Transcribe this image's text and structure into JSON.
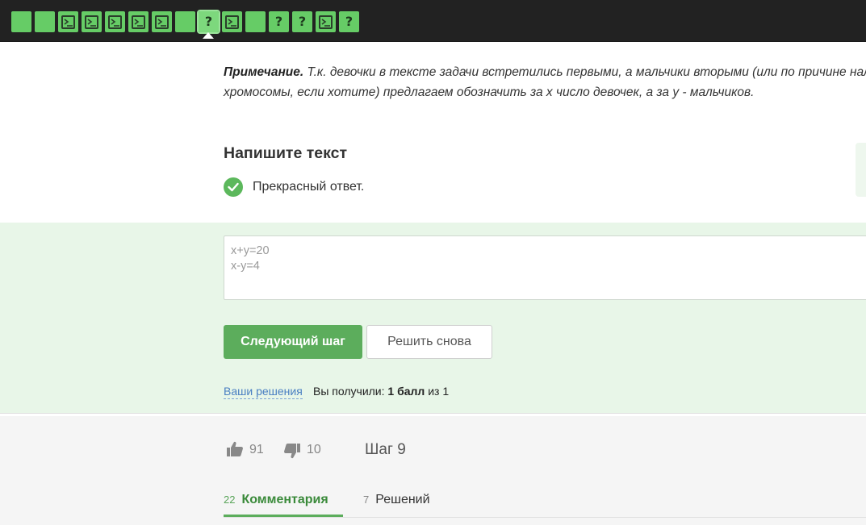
{
  "step_bar": {
    "steps": [
      {
        "kind": "plain",
        "icon": "blank-square",
        "state": "passed"
      },
      {
        "kind": "plain",
        "icon": "blank-square",
        "state": "passed"
      },
      {
        "kind": "code",
        "icon": "terminal-icon",
        "state": "passed"
      },
      {
        "kind": "code",
        "icon": "terminal-icon",
        "state": "passed"
      },
      {
        "kind": "code",
        "icon": "terminal-icon",
        "state": "passed"
      },
      {
        "kind": "code",
        "icon": "terminal-icon",
        "state": "passed"
      },
      {
        "kind": "code",
        "icon": "terminal-icon",
        "state": "passed"
      },
      {
        "kind": "plain",
        "icon": "blank-square",
        "state": "passed"
      },
      {
        "kind": "quiz",
        "icon": "question-icon",
        "label": "?",
        "state": "current"
      },
      {
        "kind": "code",
        "icon": "terminal-icon",
        "state": "passed"
      },
      {
        "kind": "plain",
        "icon": "blank-square",
        "state": "passed"
      },
      {
        "kind": "quiz",
        "icon": "question-icon",
        "label": "?",
        "state": "passed"
      },
      {
        "kind": "quiz",
        "icon": "question-icon",
        "label": "?",
        "state": "passed"
      },
      {
        "kind": "code",
        "icon": "terminal-icon",
        "state": "passed"
      },
      {
        "kind": "quiz",
        "icon": "question-icon",
        "label": "?",
        "state": "passed"
      }
    ],
    "colors": {
      "bar_bg": "#222222",
      "step_green": "#66cc66"
    }
  },
  "note": {
    "label": "Примечание.",
    "line1": " Т.к. девочки в тексте задачи встретились первыми, а мальчики вторыми (или по причине нал",
    "line2": "хромосомы, если хотите) предлагаем обозначить за x число девочек, а за y - мальчиков."
  },
  "task": {
    "title": "Напишите текст",
    "verdict": "Прекрасный ответ.",
    "verdict_icon": "check-circle-icon"
  },
  "answer": {
    "value": "x+y=20\nx-y=4"
  },
  "actions": {
    "next_label": "Следующий шаг",
    "retry_label": "Решить снова"
  },
  "result": {
    "solutions_link": "Ваши решения",
    "prefix": "Вы получили: ",
    "score": "1 балл",
    "suffix": " из 1"
  },
  "feedback": {
    "likes": "91",
    "dislikes": "10",
    "step_label": "Шаг 9"
  },
  "tabs": [
    {
      "count": "22",
      "label": "Комментария",
      "active": true
    },
    {
      "count": "7",
      "label": "Решений",
      "active": false
    }
  ],
  "colors": {
    "accent_green": "#5cad5c",
    "answer_bg": "#e8f6e8",
    "link_blue": "#4a7fc2"
  }
}
